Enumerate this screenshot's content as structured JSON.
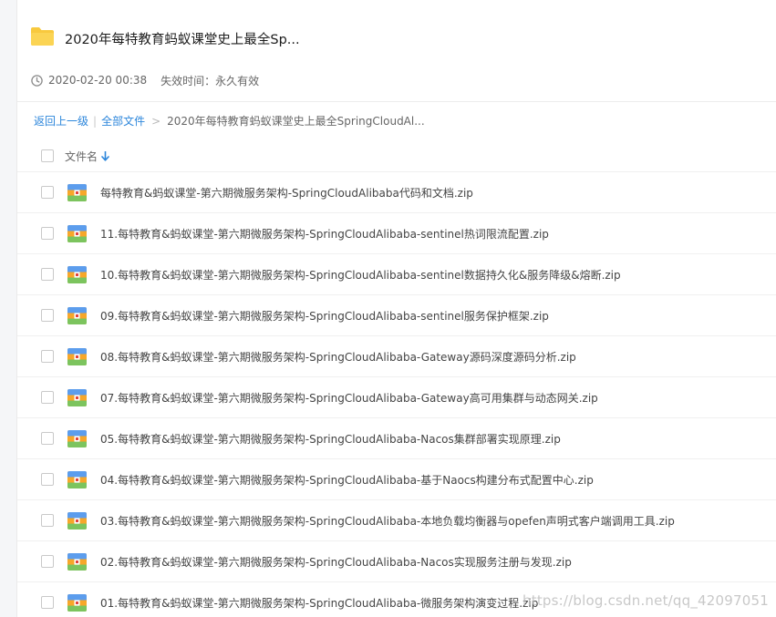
{
  "share": {
    "title": "2020年每特教育蚂蚁课堂史上最全Sp...",
    "date": "2020-02-20 00:38",
    "expiry": "失效时间：永久有效"
  },
  "breadcrumb": {
    "back": "返回上一级",
    "all_files": "全部文件",
    "current": "2020年每特教育蚂蚁课堂史上最全SpringCloudAl..."
  },
  "list_header": {
    "name_label": "文件名"
  },
  "files": [
    {
      "name": "每特教育&蚂蚁课堂-第六期微服务架构-SpringCloudAlibaba代码和文档.zip"
    },
    {
      "name": "11.每特教育&蚂蚁课堂-第六期微服务架构-SpringCloudAlibaba-sentinel热词限流配置.zip"
    },
    {
      "name": "10.每特教育&蚂蚁课堂-第六期微服务架构-SpringCloudAlibaba-sentinel数据持久化&服务降级&熔断.zip"
    },
    {
      "name": "09.每特教育&蚂蚁课堂-第六期微服务架构-SpringCloudAlibaba-sentinel服务保护框架.zip"
    },
    {
      "name": "08.每特教育&蚂蚁课堂-第六期微服务架构-SpringCloudAlibaba-Gateway源码深度源码分析.zip"
    },
    {
      "name": "07.每特教育&蚂蚁课堂-第六期微服务架构-SpringCloudAlibaba-Gateway高可用集群与动态网关.zip"
    },
    {
      "name": "05.每特教育&蚂蚁课堂-第六期微服务架构-SpringCloudAlibaba-Nacos集群部署实现原理.zip"
    },
    {
      "name": "04.每特教育&蚂蚁课堂-第六期微服务架构-SpringCloudAlibaba-基于Naocs构建分布式配置中心.zip"
    },
    {
      "name": "03.每特教育&蚂蚁课堂-第六期微服务架构-SpringCloudAlibaba-本地负载均衡器与opefen声明式客户端调用工具.zip"
    },
    {
      "name": "02.每特教育&蚂蚁课堂-第六期微服务架构-SpringCloudAlibaba-Nacos实现服务注册与发现.zip"
    },
    {
      "name": "01.每特教育&蚂蚁课堂-第六期微服务架构-SpringCloudAlibaba-微服务架构演变过程.zip"
    }
  ],
  "watermark": "https://blog.csdn.net/qq_42097051",
  "icons": {
    "folder": "folder-icon",
    "clock": "clock-icon",
    "sort": "sort-down-arrow-icon",
    "file": "zip-file-icon"
  },
  "colors": {
    "link": "#2c86db",
    "folder": "#f8c93e"
  }
}
